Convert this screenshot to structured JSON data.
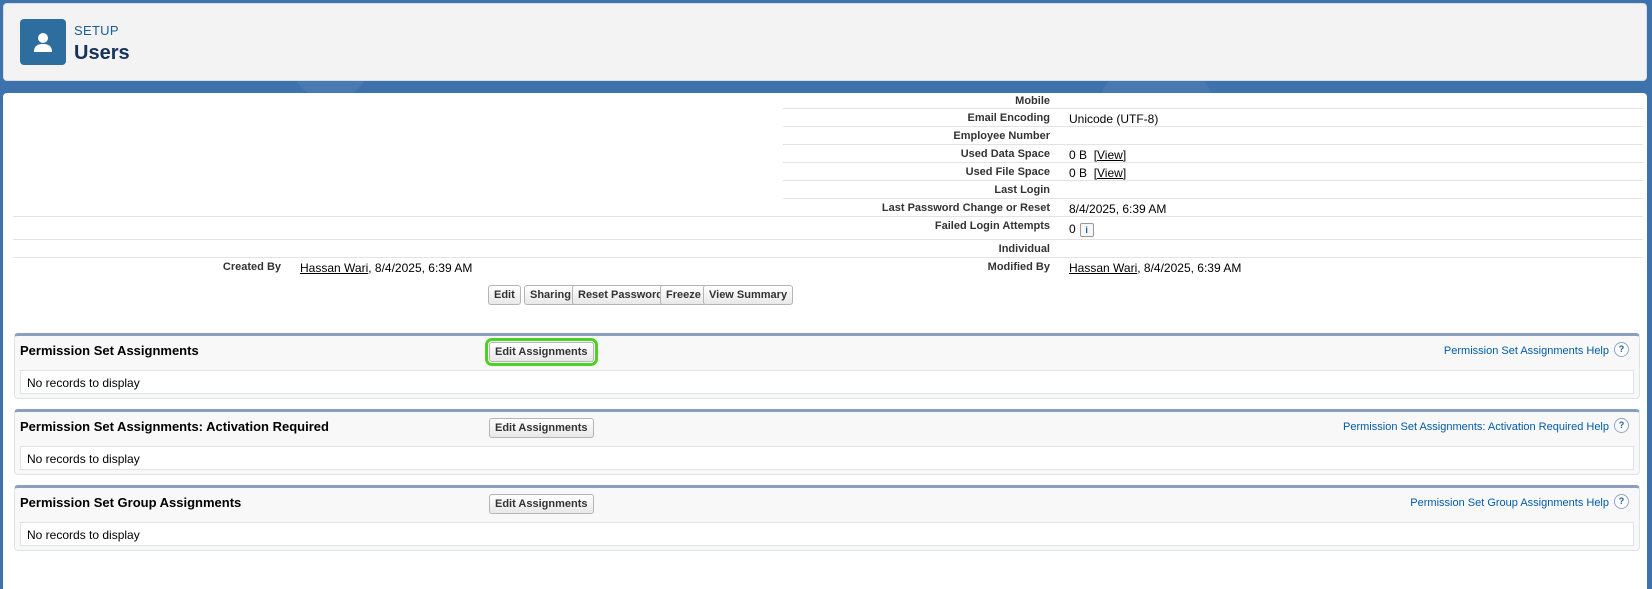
{
  "header": {
    "eyebrow": "SETUP",
    "title": "Users",
    "icon": "user-icon"
  },
  "details": {
    "mobile_label": "Mobile",
    "email_encoding_label": "Email Encoding",
    "email_encoding_value": "Unicode (UTF-8)",
    "employee_number_label": "Employee Number",
    "used_data_space_label": "Used Data Space",
    "used_data_space_value": "0 B",
    "used_file_space_label": "Used File Space",
    "used_file_space_value": "0 B",
    "view_link": "[View]",
    "last_login_label": "Last Login",
    "last_password_label": "Last Password Change or Reset",
    "last_password_value": "8/4/2025, 6:39 AM",
    "failed_login_label": "Failed Login Attempts",
    "failed_login_value": "0",
    "info_icon": "i",
    "individual_label": "Individual",
    "created_by_label": "Created By",
    "created_by_user": "Hassan Wari",
    "created_by_date": ", 8/4/2025, 6:39 AM",
    "modified_by_label": "Modified By",
    "modified_by_user": "Hassan Wari",
    "modified_by_date": ", 8/4/2025, 6:39 AM"
  },
  "buttons": {
    "edit": "Edit",
    "sharing": "Sharing",
    "reset_password": "Reset Password",
    "freeze": "Freeze",
    "view_summary": "View Summary"
  },
  "sections": [
    {
      "title": "Permission Set Assignments",
      "button": "Edit Assignments",
      "help": "Permission Set Assignments Help",
      "empty": "No records to display"
    },
    {
      "title": "Permission Set Assignments: Activation Required",
      "button": "Edit Assignments",
      "help": "Permission Set Assignments: Activation Required Help",
      "empty": "No records to display"
    },
    {
      "title": "Permission Set Group Assignments",
      "button": "Edit Assignments",
      "help": "Permission Set Group Assignments Help",
      "empty": "No records to display"
    }
  ],
  "help_icon_glyph": "?",
  "colors": {
    "highlight": "#4cd31f",
    "link": "#015ba7",
    "header_icon_bg": "#2e6e9e"
  }
}
